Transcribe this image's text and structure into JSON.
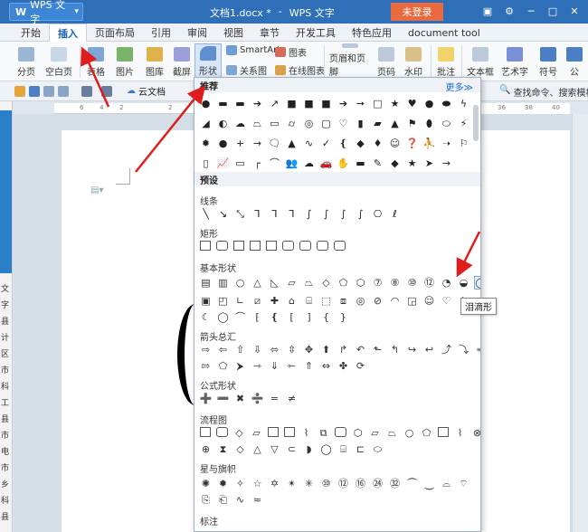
{
  "titlebar": {
    "app_name": "WPS 文字",
    "doc_name": "文档1.docx *",
    "separator": "-",
    "app_suffix": "WPS 文字",
    "login": "未登录"
  },
  "menu": [
    "开始",
    "插入",
    "页面布局",
    "引用",
    "审阅",
    "视图",
    "章节",
    "开发工具",
    "特色应用",
    "document tool"
  ],
  "ribbon": {
    "page_break": "分页",
    "blank_page": "空白页",
    "table": "表格",
    "picture": "图片",
    "gallery": "图库",
    "screenshot": "截屏",
    "shapes": "形状",
    "smartart": "SmartArt",
    "chart": "图表",
    "relation": "关系图",
    "online_chart": "在线图表",
    "header_footer": "页眉和页脚",
    "page_num": "页码",
    "watermark": "水印",
    "comment": "批注",
    "textbox": "文本框",
    "wordart": "艺术字",
    "symbol": "符号",
    "formula": "公"
  },
  "quickbar": {
    "cloud": "云文档",
    "search": "查找命令、搜索模板"
  },
  "ruler_nums": [
    "6",
    "4",
    "2",
    "2"
  ],
  "ruler_right": [
    "36",
    "38",
    "40"
  ],
  "panel": {
    "recommended": "推荐",
    "more": "更多≫",
    "preset": "预设",
    "lines": "线条",
    "rect": "矩形",
    "basic": "基本形状",
    "arrows": "箭头总汇",
    "formula": "公式形状",
    "flowchart": "流程图",
    "stars": "星与旗帜",
    "callouts": "标注",
    "tooltip": "泪滴形"
  },
  "left_texts": [
    "文",
    "字",
    "县",
    "计",
    "区",
    "市",
    "科",
    "工",
    "县",
    "市",
    "电",
    "市",
    "乡",
    "科",
    "县"
  ]
}
